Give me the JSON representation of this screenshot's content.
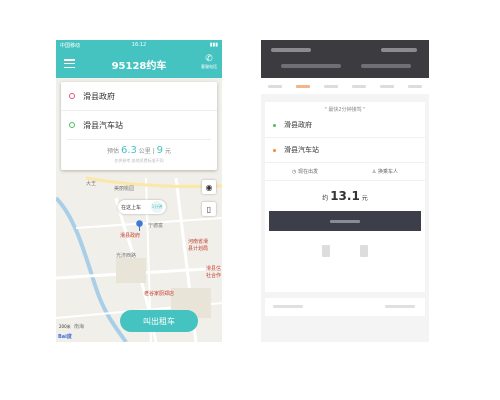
{
  "left": {
    "status": {
      "carrier": "中国移动",
      "time": "16:12"
    },
    "header": {
      "title": "95128约车",
      "call_label": "客服电话"
    },
    "addresses": [
      {
        "label": "滑县政府",
        "color": "#e05c7a"
      },
      {
        "label": "滑县汽车站",
        "color": "#4dbf5f"
      }
    ],
    "estimate": {
      "prefix": "预估",
      "distance": "6.3",
      "distance_unit": "公里",
      "sep": "|",
      "price": "9",
      "price_unit": "元",
      "note": "仅供参考,各地资费标准不同"
    },
    "map": {
      "bubble": {
        "text": "在这上车",
        "minutes": "1分钟"
      },
      "labels": {
        "mei_yuan": "美丽桃园",
        "gov": "滑县政府",
        "guangji": "光济西路",
        "henan": "河南省滑",
        "henan2": "县计划局",
        "hua": "滑县信",
        "hua2": "社合作",
        "laogu": "老谷家厨郑店",
        "dawang": "大王",
        "nanhai": "南海",
        "tianbao": "宁德富"
      },
      "scale": "200米"
    },
    "call_button": "叫出租车",
    "logo": "Bai度"
  },
  "right": {
    "hint": "\" 最快2分钟接驾 \"",
    "addresses": [
      {
        "label": "滑县政府",
        "color": "#4dbf5f"
      },
      {
        "label": "滑县汽车站",
        "color": "#f08a3c"
      }
    ],
    "options": {
      "now": "现在出发",
      "change": "换乘车人"
    },
    "price": {
      "prefix": "约",
      "value": "13.1",
      "unit": "元"
    }
  },
  "colors": {
    "brand": "#45c3c0",
    "dark": "#3c3e4a"
  }
}
